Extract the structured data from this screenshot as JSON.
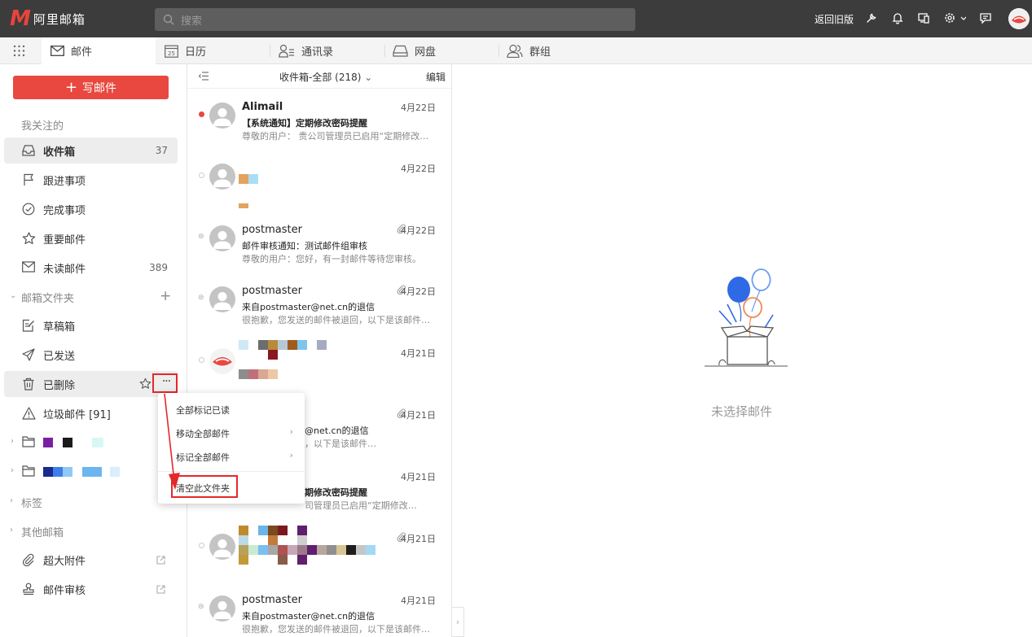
{
  "app": {
    "logo_mark": "M",
    "logo_text": "阿里邮箱",
    "search_placeholder": "搜索",
    "back_old_label": "返回旧版",
    "brand_color": "#e8483f"
  },
  "tabs": [
    {
      "label": "邮件",
      "icon": "mail-icon",
      "active": true
    },
    {
      "label": "日历",
      "icon": "calendar-icon",
      "active": false
    },
    {
      "label": "通讯录",
      "icon": "contacts-icon",
      "active": false
    },
    {
      "label": "网盘",
      "icon": "cloud-drive-icon",
      "active": false
    },
    {
      "label": "群组",
      "icon": "group-icon",
      "active": false
    }
  ],
  "calendar_day": "25",
  "sidebar": {
    "compose_label": "写邮件",
    "favorites_label": "我关注的",
    "items": [
      {
        "label": "收件箱",
        "count": "37",
        "icon": "inbox-icon",
        "selected": true
      },
      {
        "label": "跟进事项",
        "count": "",
        "icon": "flag-icon"
      },
      {
        "label": "完成事项",
        "count": "",
        "icon": "check-circle-icon"
      },
      {
        "label": "重要邮件",
        "count": "",
        "icon": "star-icon"
      },
      {
        "label": "未读邮件",
        "count": "389",
        "icon": "envelope-icon"
      }
    ],
    "folders_label": "邮箱文件夹",
    "folders": [
      {
        "label": "草稿箱",
        "icon": "draft-icon"
      },
      {
        "label": "已发送",
        "icon": "sent-icon"
      },
      {
        "label": "已删除",
        "icon": "trash-icon"
      },
      {
        "label": "垃圾邮件 [91]",
        "icon": "warning-icon"
      }
    ],
    "tags_label": "标签",
    "other_label": "其他邮箱",
    "tools": [
      {
        "label": "超大附件",
        "icon": "paperclip-icon"
      },
      {
        "label": "邮件审核",
        "icon": "stamp-icon"
      }
    ]
  },
  "context_menu": {
    "items": [
      {
        "label": "全部标记已读",
        "submenu": false
      },
      {
        "label": "移动全部邮件",
        "submenu": true
      },
      {
        "label": "标记全部邮件",
        "submenu": true
      },
      {
        "label": "清空此文件夹",
        "submenu": false
      }
    ]
  },
  "mail_list": {
    "header_title": "收件箱-全部 (218)",
    "edit_label": "编辑",
    "mails": [
      {
        "from": "Alimail",
        "date": "4月22日",
        "subject": "【系统通知】定期修改密码提醒",
        "preview": "尊敬的用户：   贵公司管理员已启用“定期修改…",
        "unread": true,
        "attachment": false
      },
      {
        "from": "",
        "date": "4月22日",
        "subject": "",
        "preview": "",
        "unread": false,
        "attachment": false
      },
      {
        "from": "postmaster",
        "date": "4月22日",
        "subject": "邮件审核通知：测试邮件组审核",
        "preview": "尊敬的用户：您好，有一封邮件等待您审核。",
        "unread": false,
        "attachment": true
      },
      {
        "from": "postmaster",
        "date": "4月22日",
        "subject": "来自postmaster@net.cn的退信",
        "preview": "很抱歉，您发送的邮件被退回，以下是该邮件…",
        "unread": false,
        "attachment": true
      },
      {
        "from": "",
        "date": "4月21日",
        "subject": "",
        "preview": "",
        "unread": false,
        "attachment": false
      },
      {
        "from": "",
        "date": "4月21日",
        "subject": "@net.cn的退信",
        "preview": "，以下是该邮件…",
        "unread": false,
        "attachment": true
      },
      {
        "from": "",
        "date": "4月21日",
        "subject": "期修改密码提醒",
        "preview": "司管理员已启用“定期修改…",
        "unread": false,
        "attachment": false
      },
      {
        "from": "",
        "date": "4月21日",
        "subject": "",
        "preview": "",
        "unread": false,
        "attachment": true
      },
      {
        "from": "postmaster",
        "date": "4月21日",
        "subject": "来自postmaster@net.cn的退信",
        "preview": "很抱歉，您发送的邮件被退回，以下是该邮件…",
        "unread": false,
        "attachment": false
      }
    ]
  },
  "reading_pane": {
    "empty_text": "未选择邮件"
  }
}
